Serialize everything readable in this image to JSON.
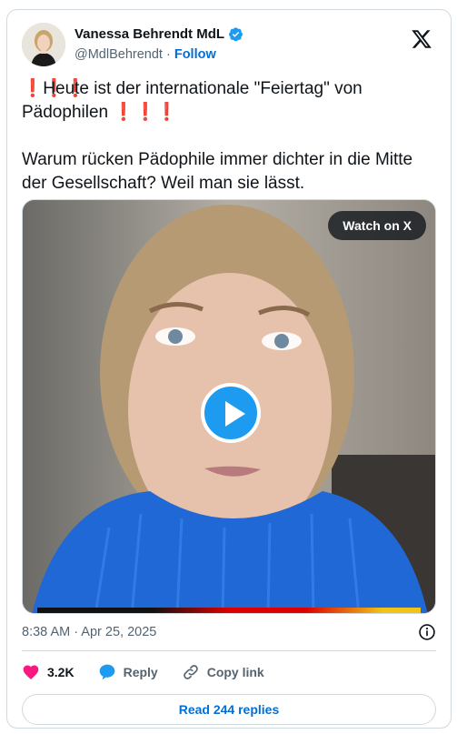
{
  "author": {
    "name": "Vanessa Behrendt MdL",
    "handle": "@MdlBehrendt",
    "separator": "·",
    "follow_label": "Follow"
  },
  "tweet": {
    "line1_prefix": "❗❗❗",
    "line1_text": " Heute ist der internationale \"Feiertag\" von Pädophilen ",
    "line1_suffix": "❗❗❗",
    "paragraph2": "Warum rücken Pädophile immer dichter in die Mitte der Gesellschaft? Weil man sie lässt."
  },
  "media": {
    "watch_label": "Watch on X"
  },
  "timestamp": "8:38 AM · Apr 25, 2025",
  "actions": {
    "likes_count": "3.2K",
    "reply_label": "Reply",
    "copy_link_label": "Copy link"
  },
  "read_replies_label": "Read 244 replies",
  "colors": {
    "accent": "#1d9bf0",
    "link": "#006fd6",
    "like": "#f91880",
    "muted": "#536471"
  }
}
